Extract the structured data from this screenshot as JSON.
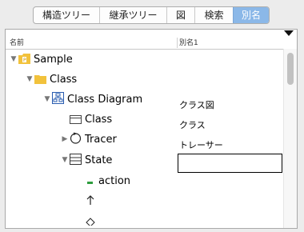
{
  "tabs": [
    {
      "label": "構造ツリー",
      "active": false
    },
    {
      "label": "継承ツリー",
      "active": false
    },
    {
      "label": "図",
      "active": false
    },
    {
      "label": "検索",
      "active": false
    },
    {
      "label": "別名",
      "active": true
    }
  ],
  "columns": {
    "name": "名前",
    "alias": "別名1"
  },
  "tree": {
    "sample": "Sample",
    "class_pkg": "Class",
    "class_diagram": "Class Diagram",
    "class_item": "Class",
    "tracer": "Tracer",
    "state": "State",
    "action": "action"
  },
  "aliases": {
    "class_diagram": "クラス図",
    "class_item": "クラス",
    "tracer": "トレーサー",
    "state_edit": ""
  }
}
